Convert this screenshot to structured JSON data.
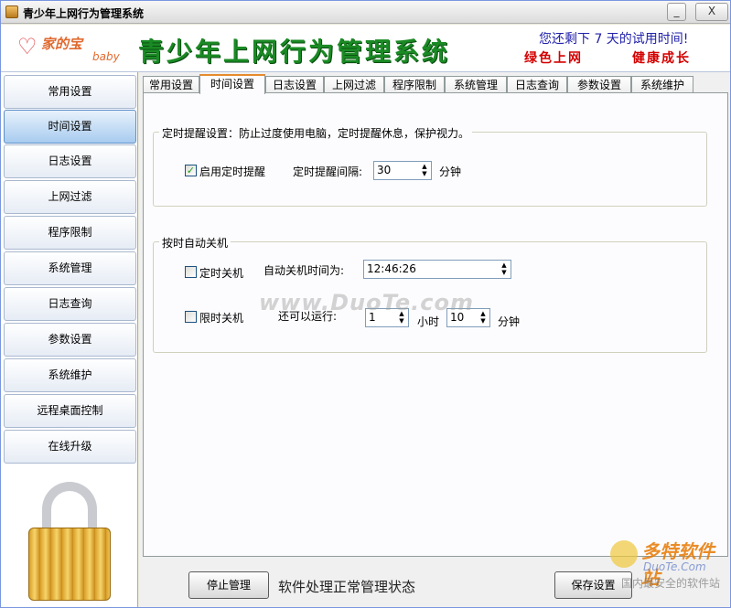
{
  "window": {
    "title": "青少年上网行为管理系统",
    "min_label": "_",
    "close_label": "X"
  },
  "header": {
    "logo_text": "家的宝",
    "logo_sub": "baby",
    "banner": "青少年上网行为管理系统",
    "trial_text": "您还剩下 7 天的试用时间!",
    "slogan_left": "绿色上网",
    "slogan_right": "健康成长"
  },
  "sidebar": {
    "items": [
      {
        "label": "常用设置"
      },
      {
        "label": "时间设置"
      },
      {
        "label": "日志设置"
      },
      {
        "label": "上网过滤"
      },
      {
        "label": "程序限制"
      },
      {
        "label": "系统管理"
      },
      {
        "label": "日志查询"
      },
      {
        "label": "参数设置"
      },
      {
        "label": "系统维护"
      },
      {
        "label": "远程桌面控制"
      },
      {
        "label": "在线升级"
      }
    ],
    "active_index": 1
  },
  "tabs": [
    {
      "label": "常用设置"
    },
    {
      "label": "时间设置"
    },
    {
      "label": "日志设置"
    },
    {
      "label": "上网过滤"
    },
    {
      "label": "程序限制"
    },
    {
      "label": "系统管理"
    },
    {
      "label": "日志查询"
    },
    {
      "label": "参数设置"
    },
    {
      "label": "系统维护"
    }
  ],
  "active_tab": 1,
  "reminder_group": {
    "title": "定时提醒设置：防止过度使用电脑，定时提醒休息，保护视力。",
    "enable_label": "启用定时提醒",
    "enable_checked": true,
    "check_mark": "✓",
    "interval_label": "定时提醒间隔:",
    "interval_value": "30",
    "interval_unit": "分钟"
  },
  "shutdown_group": {
    "title": "按时自动关机",
    "timed_label": "定时关机",
    "timed_checked": false,
    "time_label": "自动关机时间为:",
    "time_value": "12:46:26",
    "limit_label": "限时关机",
    "limit_checked": false,
    "remain_label": "还可以运行:",
    "hours_value": "1",
    "hours_unit": "小时",
    "minutes_value": "10",
    "minutes_unit": "分钟"
  },
  "bottom": {
    "stop_label": "停止管理",
    "status_text": "软件处理正常管理状态",
    "save_label": "保存设置"
  },
  "watermark": {
    "center": "www.DuoTe.com",
    "corner_title": "多特软件站",
    "corner_url": "DuoTe.Com",
    "corner_slogan": "国内最安全的软件站"
  }
}
